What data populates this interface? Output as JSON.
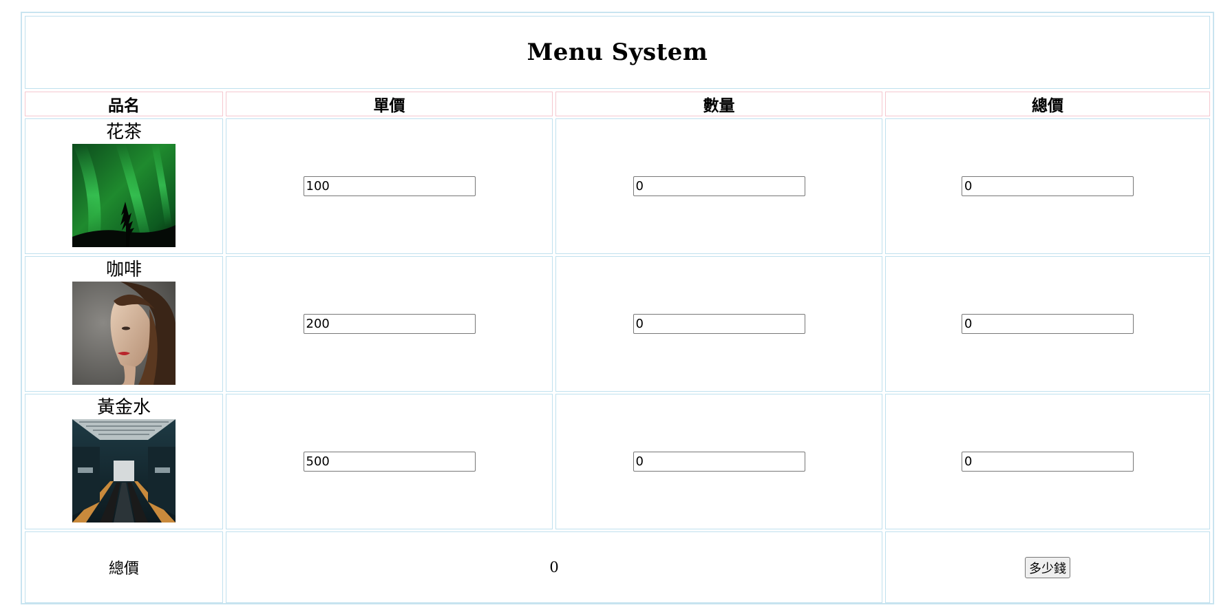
{
  "title": "Menu System",
  "headers": {
    "name": "品名",
    "unit_price": "單價",
    "quantity": "數量",
    "subtotal": "總價"
  },
  "items": [
    {
      "name": "花茶",
      "unit_price": "100",
      "quantity": "0",
      "subtotal": "0"
    },
    {
      "name": "咖啡",
      "unit_price": "200",
      "quantity": "0",
      "subtotal": "0"
    },
    {
      "name": "黃金水",
      "unit_price": "500",
      "quantity": "0",
      "subtotal": "0"
    }
  ],
  "footer": {
    "label": "總價",
    "total": "0",
    "button_label": "多少錢"
  },
  "colors": {
    "table_border": "#bfe0ee",
    "header_border": "#f5c7cf"
  }
}
